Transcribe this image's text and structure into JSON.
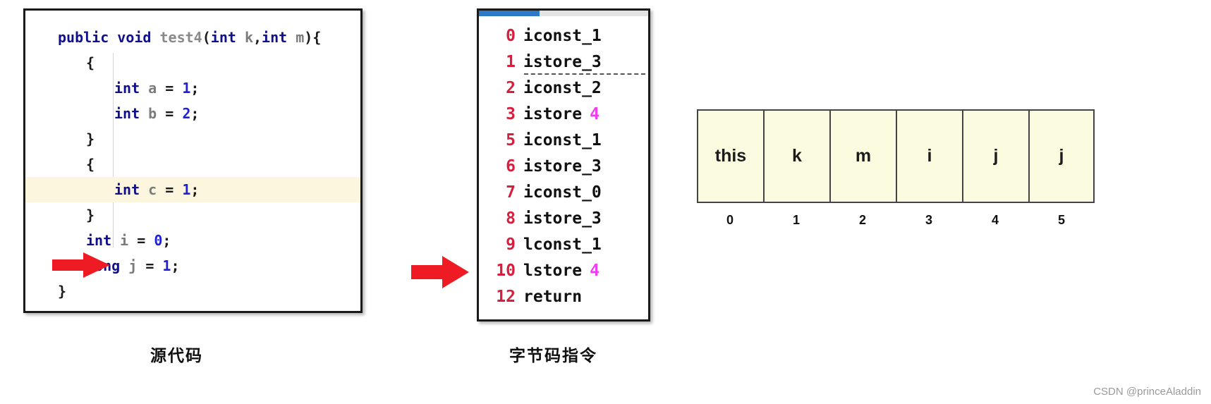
{
  "source_panel": {
    "name": "source-code-editor",
    "lines": [
      {
        "indent": 0,
        "tokens": [
          {
            "t": "public ",
            "c": "kw"
          },
          {
            "t": "void ",
            "c": "kw"
          },
          {
            "t": "test4",
            "c": "mth"
          },
          {
            "t": "(",
            "c": "pun"
          },
          {
            "t": "int ",
            "c": "kw"
          },
          {
            "t": "k",
            "c": "var"
          },
          {
            "t": ",",
            "c": "pun"
          },
          {
            "t": "int ",
            "c": "kw"
          },
          {
            "t": "m",
            "c": "var"
          },
          {
            "t": "){",
            "c": "pun"
          }
        ],
        "highlight": false
      },
      {
        "indent": 1,
        "tokens": [
          {
            "t": "{",
            "c": "pun"
          }
        ],
        "highlight": false
      },
      {
        "indent": 2,
        "tokens": [
          {
            "t": "int ",
            "c": "kw"
          },
          {
            "t": "a ",
            "c": "var"
          },
          {
            "t": "= ",
            "c": "pun"
          },
          {
            "t": "1",
            "c": "num"
          },
          {
            "t": ";",
            "c": "pun"
          }
        ],
        "highlight": false
      },
      {
        "indent": 2,
        "tokens": [
          {
            "t": "int ",
            "c": "kw"
          },
          {
            "t": "b ",
            "c": "var"
          },
          {
            "t": "= ",
            "c": "pun"
          },
          {
            "t": "2",
            "c": "num"
          },
          {
            "t": ";",
            "c": "pun"
          }
        ],
        "highlight": false
      },
      {
        "indent": 1,
        "tokens": [
          {
            "t": "}",
            "c": "pun"
          }
        ],
        "highlight": false
      },
      {
        "indent": 1,
        "tokens": [
          {
            "t": "{",
            "c": "pun"
          }
        ],
        "highlight": false
      },
      {
        "indent": 2,
        "tokens": [
          {
            "t": "int ",
            "c": "kw"
          },
          {
            "t": "c ",
            "c": "var"
          },
          {
            "t": "= ",
            "c": "pun"
          },
          {
            "t": "1",
            "c": "num"
          },
          {
            "t": ";",
            "c": "pun"
          }
        ],
        "highlight": true
      },
      {
        "indent": 1,
        "tokens": [
          {
            "t": "}",
            "c": "pun"
          }
        ],
        "highlight": false
      },
      {
        "indent": 1,
        "tokens": [
          {
            "t": "int ",
            "c": "kw"
          },
          {
            "t": "i ",
            "c": "var"
          },
          {
            "t": "= ",
            "c": "pun"
          },
          {
            "t": "0",
            "c": "num"
          },
          {
            "t": ";",
            "c": "pun"
          }
        ],
        "highlight": false
      },
      {
        "indent": 1,
        "tokens": [
          {
            "t": "long ",
            "c": "kw"
          },
          {
            "t": "j ",
            "c": "var"
          },
          {
            "t": "= ",
            "c": "pun"
          },
          {
            "t": "1",
            "c": "num"
          },
          {
            "t": ";",
            "c": "pun"
          }
        ],
        "highlight": false
      },
      {
        "indent": 0,
        "tokens": [
          {
            "t": "}",
            "c": "pun"
          }
        ],
        "highlight": false
      }
    ]
  },
  "bytecode_panel": {
    "name": "bytecode-instructions",
    "rows": [
      {
        "index": "0",
        "op": "iconst_1",
        "operand": "",
        "dashed": false
      },
      {
        "index": "1",
        "op": "istore_3",
        "operand": "",
        "dashed": true
      },
      {
        "index": "2",
        "op": "iconst_2",
        "operand": "",
        "dashed": false
      },
      {
        "index": "3",
        "op": "istore",
        "operand": "4",
        "dashed": false
      },
      {
        "index": "5",
        "op": "iconst_1",
        "operand": "",
        "dashed": false
      },
      {
        "index": "6",
        "op": "istore_3",
        "operand": "",
        "dashed": false
      },
      {
        "index": "7",
        "op": "iconst_0",
        "operand": "",
        "dashed": false
      },
      {
        "index": "8",
        "op": "istore_3",
        "operand": "",
        "dashed": false
      },
      {
        "index": "9",
        "op": "lconst_1",
        "operand": "",
        "dashed": false
      },
      {
        "index": "10",
        "op": "lstore",
        "operand": "4",
        "dashed": false
      },
      {
        "index": "12",
        "op": "return",
        "operand": "",
        "dashed": false
      }
    ]
  },
  "slot_table": {
    "name": "local-variable-slot-table",
    "cells": [
      "this",
      "k",
      "m",
      "i",
      "j",
      "j"
    ],
    "indices": [
      "0",
      "1",
      "2",
      "3",
      "4",
      "5"
    ]
  },
  "captions": {
    "source": "源代码",
    "bytecode": "字节码指令"
  },
  "watermark": "CSDN @princeAladdin",
  "colors": {
    "keyword": "#10108c",
    "number": "#2020d8",
    "variable": "#7b7b7b",
    "bytecode_index": "#d81e3c",
    "bytecode_operand": "#f13ef1",
    "arrow": "#ee1b24",
    "highlight_row": "#fdf6df",
    "slot_fill": "#fbfbe0",
    "scrollbar_thumb": "#2d79c7"
  }
}
